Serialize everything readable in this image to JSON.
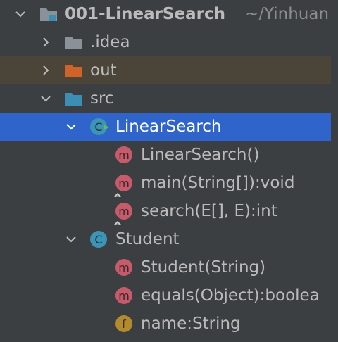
{
  "project": {
    "name": "001-LinearSearch",
    "path": "~/Yinhuan"
  },
  "nodes": {
    "idea": "idea",
    "idea_prefix": ".",
    "out": "out",
    "src": "src",
    "linear_search_class": "LinearSearch",
    "ls_constructor": "LinearSearch()",
    "ls_main": "main(String[]):void",
    "ls_search": "search(E[], E):int",
    "student_class": "Student",
    "st_constructor": "Student(String)",
    "st_equals": "equals(Object):boolea",
    "st_name": "name:String"
  },
  "badges": {
    "method": "m",
    "class": "C",
    "field": "f"
  },
  "colors": {
    "background": "#3c3f41",
    "selection": "#2f65ca",
    "excluded_row": "#4a4538",
    "folder_grey": "#8a9199",
    "folder_orange": "#d0632a",
    "folder_blue": "#3c8fb3",
    "method_badge": "#c65b6b",
    "class_badge": "#3d95b6",
    "field_badge": "#b38a2e"
  }
}
